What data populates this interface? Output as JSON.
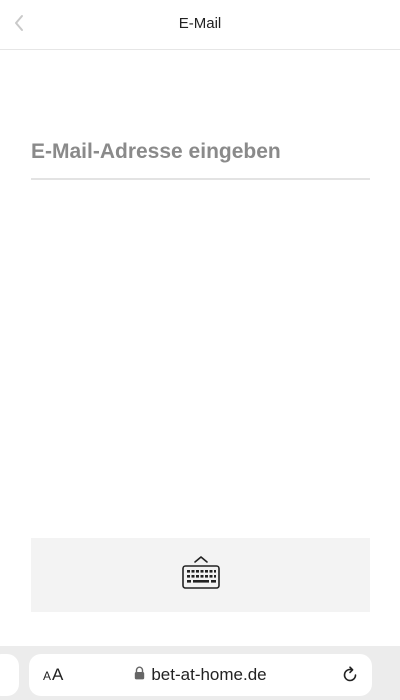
{
  "header": {
    "title": "E-Mail",
    "back_icon": "chevron-left-icon"
  },
  "form": {
    "email_placeholder": "E-Mail-Adresse eingeben",
    "email_value": ""
  },
  "keyboard_panel": {
    "icon": "keyboard-icon"
  },
  "browser": {
    "text_size_small": "A",
    "text_size_large": "A",
    "url": "bet-at-home.de",
    "lock_icon": "lock-icon",
    "reload_icon": "reload-icon"
  },
  "colors": {
    "background": "#ffffff",
    "divider": "#e6e6e6",
    "placeholder": "#8a8a8a",
    "panel": "#f3f3f3",
    "browser_bar": "#ececec"
  }
}
